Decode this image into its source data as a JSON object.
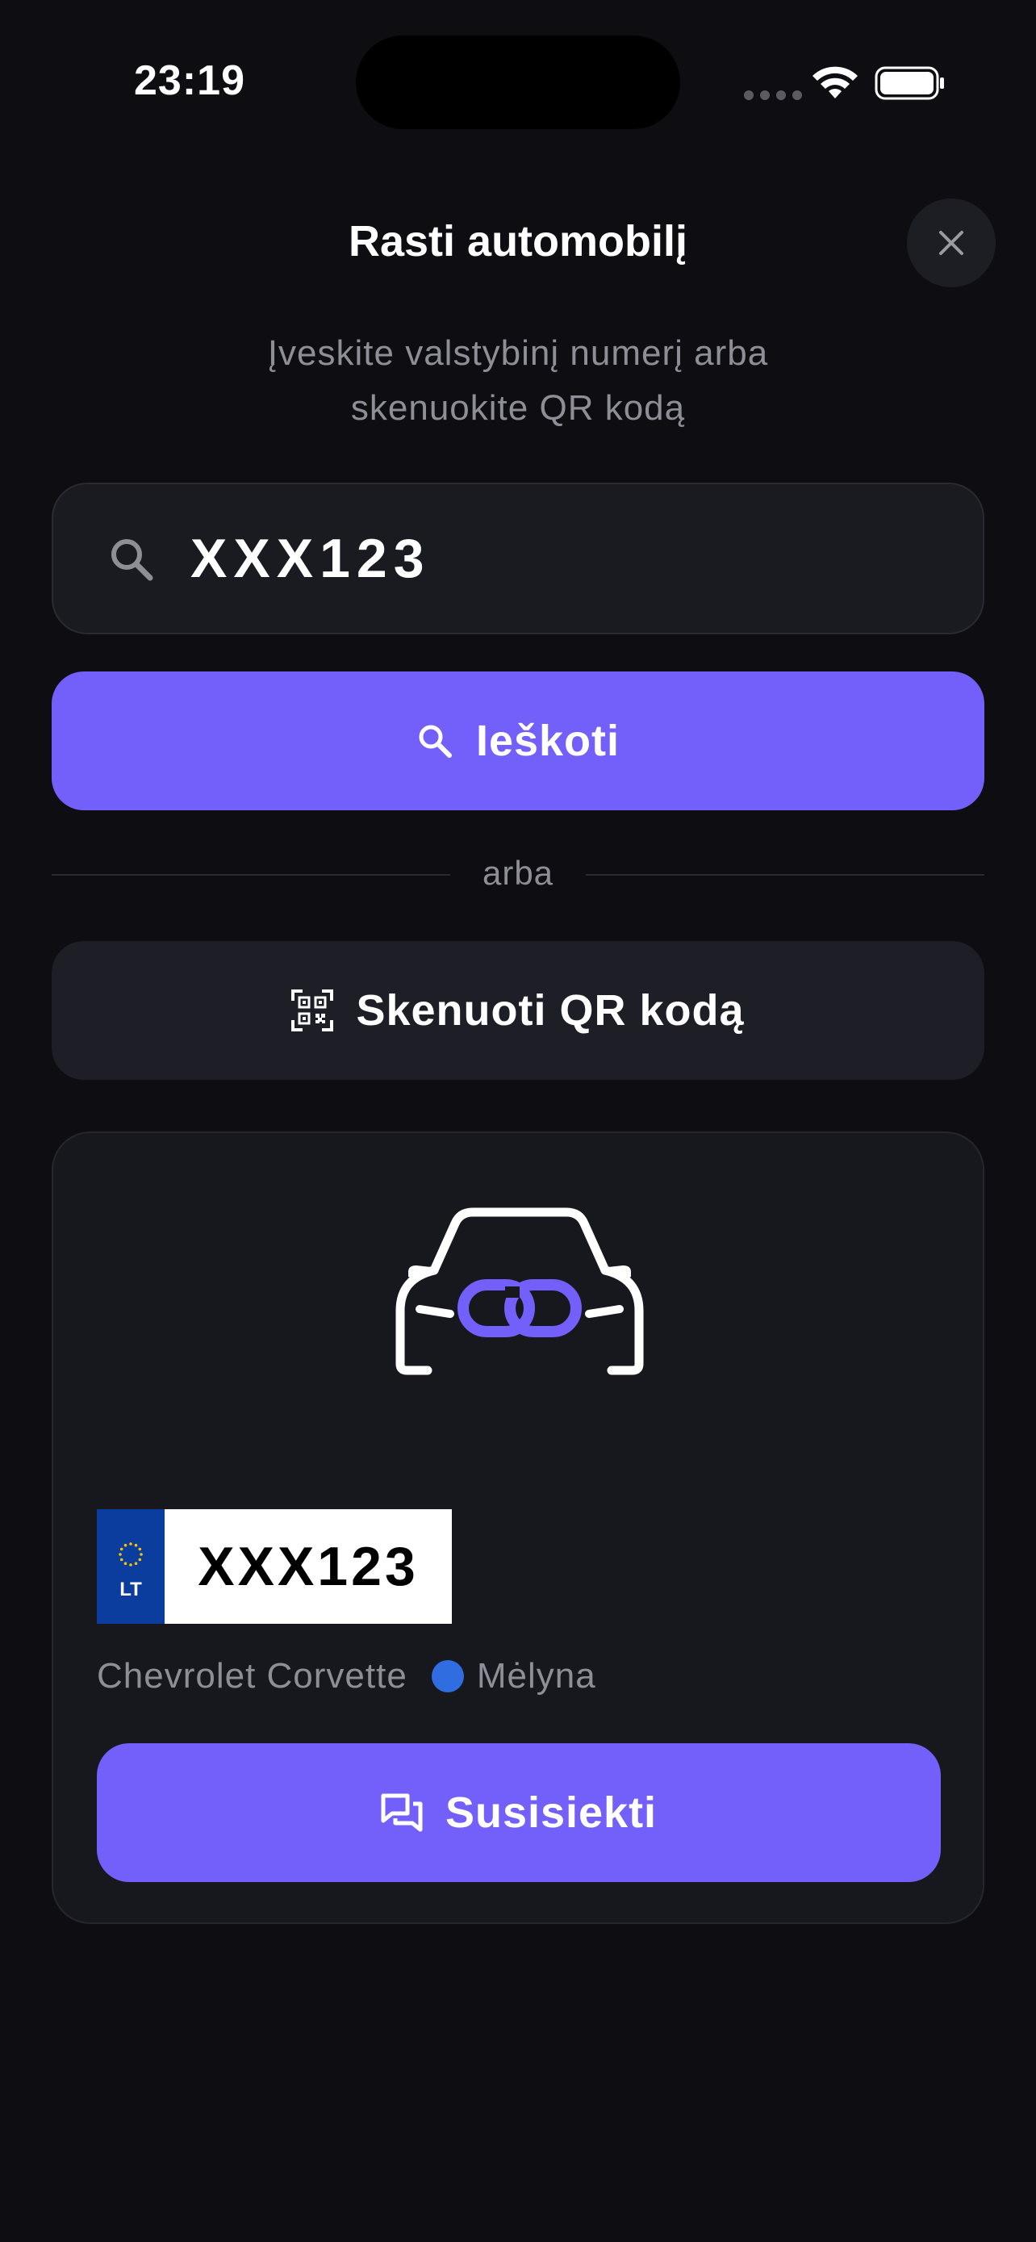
{
  "status_bar": {
    "time": "23:19"
  },
  "header": {
    "title": "Rasti automobilį",
    "subtitle_line1": "Įveskite valstybinį numerį arba",
    "subtitle_line2": "skenuokite QR kodą"
  },
  "search": {
    "value": "XXX123",
    "button_label": "Ieškoti"
  },
  "divider": {
    "label": "arba"
  },
  "qr": {
    "button_label": "Skenuoti QR kodą"
  },
  "result": {
    "plate_country": "LT",
    "plate_number": "XXX123",
    "car_model": "Chevrolet Corvette",
    "car_color_name": "Mėlyna",
    "car_color_hex": "#2f6de1",
    "contact_button_label": "Susisiekti"
  },
  "colors": {
    "accent": "#7360fa",
    "background": "#0e0e12",
    "card": "#17181d"
  },
  "icons": {
    "close": "close-icon",
    "search": "search-icon",
    "qr": "qr-code-icon",
    "car": "car-link-icon",
    "chat": "chat-icon"
  }
}
